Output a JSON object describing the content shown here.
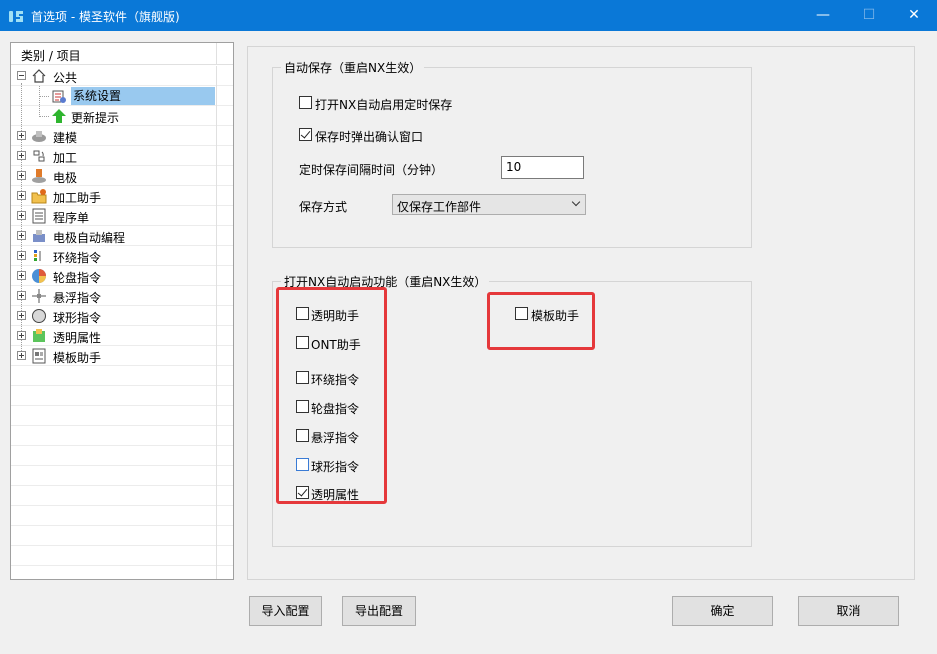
{
  "window": {
    "title": "首选项 - 模圣软件（旗舰版)"
  },
  "tree": {
    "header": "类别 / 项目",
    "items": [
      {
        "label": "公共",
        "icon": "home-icon"
      },
      {
        "label": "系统设置",
        "icon": "settings-icon"
      },
      {
        "label": "更新提示",
        "icon": "arrow-up-icon"
      },
      {
        "label": "建模",
        "icon": "modeling-icon"
      },
      {
        "label": "加工",
        "icon": "machining-icon"
      },
      {
        "label": "电极",
        "icon": "electrode-icon"
      },
      {
        "label": "加工助手",
        "icon": "folder-assist-icon"
      },
      {
        "label": "程序单",
        "icon": "program-sheet-icon"
      },
      {
        "label": "电极自动编程",
        "icon": "electrode-auto-icon"
      },
      {
        "label": "环绕指令",
        "icon": "surround-icon"
      },
      {
        "label": "轮盘指令",
        "icon": "wheel-icon"
      },
      {
        "label": "悬浮指令",
        "icon": "float-icon"
      },
      {
        "label": "球形指令",
        "icon": "sphere-icon"
      },
      {
        "label": "透明属性",
        "icon": "transparent-icon"
      },
      {
        "label": "模板助手",
        "icon": "template-icon"
      }
    ]
  },
  "autosave": {
    "title": "自动保存（重启NX生效）",
    "enable_timer": {
      "label": "打开NX自动启用定时保存",
      "checked": false
    },
    "confirm_popup": {
      "label": "保存时弹出确认窗口",
      "checked": true
    },
    "interval_label": "定时保存间隔时间（分钟）",
    "interval_value": "10",
    "mode_label": "保存方式",
    "mode_value": "仅保存工作部件"
  },
  "startup": {
    "title": "打开NX自动启动功能（重启NX生效）",
    "options": [
      {
        "label": "透明助手",
        "checked": false
      },
      {
        "label": "ONT助手",
        "checked": false
      },
      {
        "label": "环绕指令",
        "checked": false
      },
      {
        "label": "轮盘指令",
        "checked": false
      },
      {
        "label": "悬浮指令",
        "checked": false
      },
      {
        "label": "球形指令",
        "checked": false
      },
      {
        "label": "透明属性",
        "checked": true
      }
    ],
    "template_helper": {
      "label": "模板助手",
      "checked": false
    }
  },
  "buttons": {
    "import": "导入配置",
    "export": "导出配置",
    "ok": "确定",
    "cancel": "取消"
  },
  "colors": {
    "titlebar": "#0a78d7",
    "highlight": "#e5383b",
    "selection": "#99c9ef"
  }
}
